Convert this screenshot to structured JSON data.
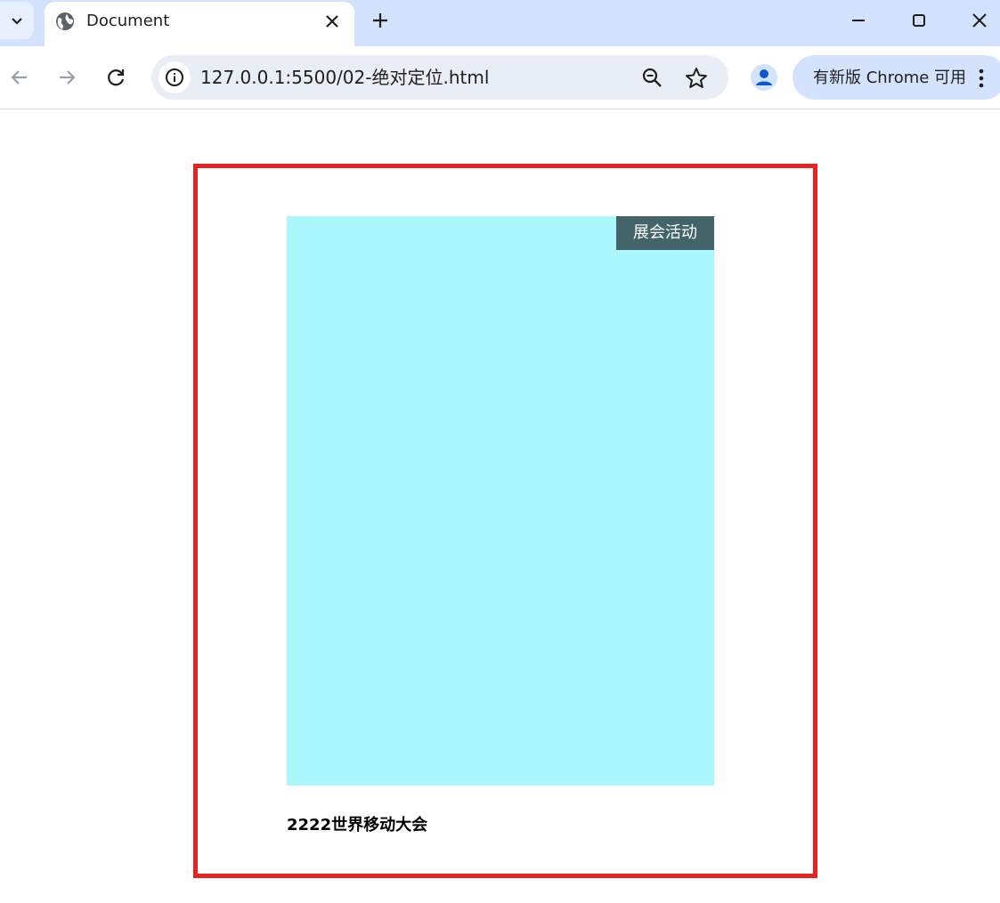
{
  "browser": {
    "tab": {
      "title": "Document"
    },
    "address_bar": {
      "url": "127.0.0.1:5500/02-绝对定位.html"
    },
    "update_chip": {
      "label": "有新版 Chrome 可用"
    }
  },
  "page": {
    "badge_label": "展会活动",
    "caption": "2222世界移动大会",
    "colors": {
      "outer_border": "#e62222",
      "image_placeholder": "#aaf7fd",
      "badge_background": "#436468",
      "badge_text": "#ffffff"
    }
  },
  "icons": [
    "tab-search-icon",
    "globe-icon",
    "close-icon",
    "plus-icon",
    "minimize-icon",
    "maximize-icon",
    "back-arrow-icon",
    "forward-arrow-icon",
    "reload-icon",
    "info-icon",
    "zoom-out-icon",
    "star-icon",
    "profile-icon",
    "more-vert-icon"
  ]
}
